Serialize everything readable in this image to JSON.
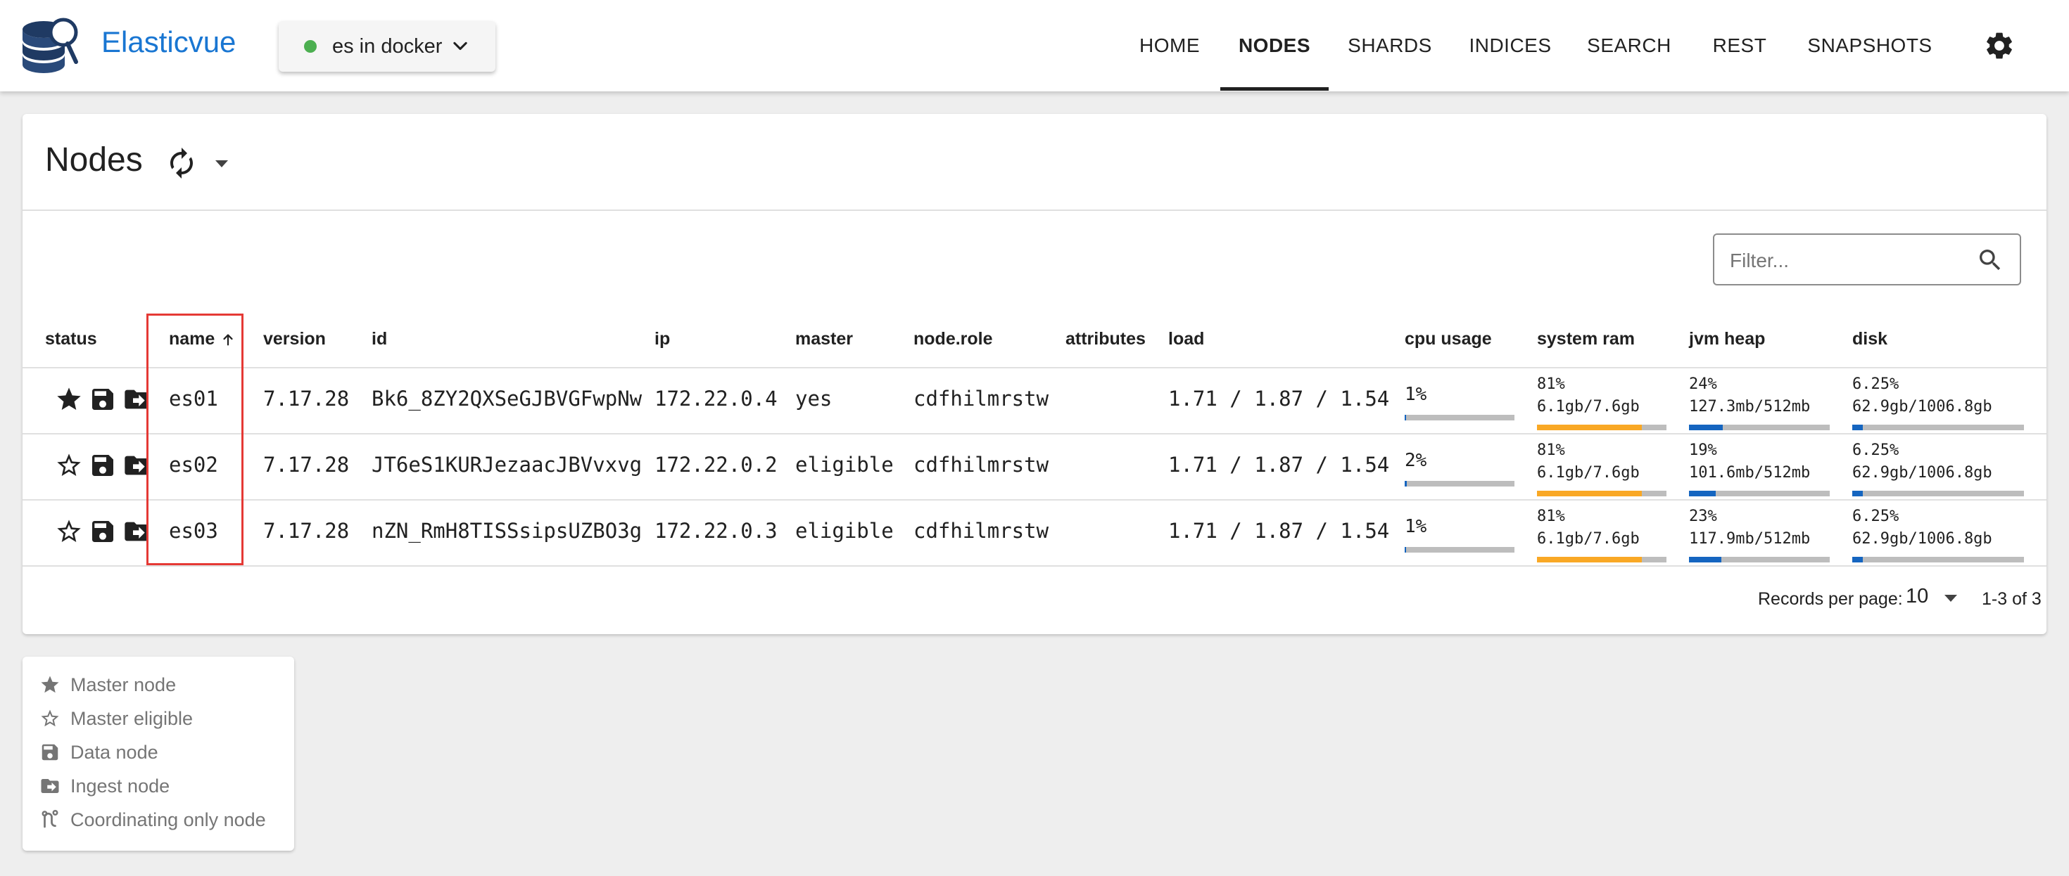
{
  "app": {
    "title": "Elasticvue"
  },
  "cluster": {
    "label": "es in docker",
    "status_color": "#4caf50"
  },
  "nav": [
    {
      "label": "HOME"
    },
    {
      "label": "NODES",
      "active": true
    },
    {
      "label": "SHARDS"
    },
    {
      "label": "INDICES"
    },
    {
      "label": "SEARCH"
    },
    {
      "label": "REST"
    },
    {
      "label": "SNAPSHOTS"
    }
  ],
  "page": {
    "title": "Nodes"
  },
  "filter": {
    "placeholder": "Filter...",
    "value": ""
  },
  "table": {
    "columns": [
      "status",
      "name",
      "version",
      "id",
      "ip",
      "master",
      "node.role",
      "attributes",
      "load",
      "cpu usage",
      "system ram",
      "jvm heap",
      "disk"
    ],
    "sort": {
      "column": "name",
      "direction": "ascending"
    },
    "rows": [
      {
        "status": [
          "master-node",
          "data-node",
          "ingest-node"
        ],
        "name": "es01",
        "version": "7.17.28",
        "id": "Bk6_8ZY2QXSeGJBVGFwpNw",
        "ip": "172.22.0.4",
        "master": "yes",
        "role": "cdfhilmrstw",
        "attributes": "",
        "load": "1.71 / 1.87 / 1.54",
        "cpu": {
          "pct": "1%",
          "value": 1
        },
        "ram": {
          "pct": "81%",
          "detail": "6.1gb/7.6gb",
          "value": 81
        },
        "heap": {
          "pct": "24%",
          "detail": "127.3mb/512mb",
          "value": 24
        },
        "disk": {
          "pct": "6.25%",
          "detail": "62.9gb/1006.8gb",
          "value": 6.25
        }
      },
      {
        "status": [
          "master-eligible",
          "data-node",
          "ingest-node"
        ],
        "name": "es02",
        "version": "7.17.28",
        "id": "JT6eS1KURJezaacJBVvxvg",
        "ip": "172.22.0.2",
        "master": "eligible",
        "role": "cdfhilmrstw",
        "attributes": "",
        "load": "1.71 / 1.87 / 1.54",
        "cpu": {
          "pct": "2%",
          "value": 2
        },
        "ram": {
          "pct": "81%",
          "detail": "6.1gb/7.6gb",
          "value": 81
        },
        "heap": {
          "pct": "19%",
          "detail": "101.6mb/512mb",
          "value": 19
        },
        "disk": {
          "pct": "6.25%",
          "detail": "62.9gb/1006.8gb",
          "value": 6.25
        }
      },
      {
        "status": [
          "master-eligible",
          "data-node",
          "ingest-node"
        ],
        "name": "es03",
        "version": "7.17.28",
        "id": "nZN_RmH8TISSsipsUZBO3g",
        "ip": "172.22.0.3",
        "master": "eligible",
        "role": "cdfhilmrstw",
        "attributes": "",
        "load": "1.71 / 1.87 / 1.54",
        "cpu": {
          "pct": "1%",
          "value": 1
        },
        "ram": {
          "pct": "81%",
          "detail": "6.1gb/7.6gb",
          "value": 81
        },
        "heap": {
          "pct": "23%",
          "detail": "117.9mb/512mb",
          "value": 23
        },
        "disk": {
          "pct": "6.25%",
          "detail": "62.9gb/1006.8gb",
          "value": 6.25
        }
      }
    ]
  },
  "pagination": {
    "label": "Records per page:",
    "per_page": "10",
    "range": "1-3 of 3"
  },
  "legend": [
    {
      "icon": "star-filled-icon",
      "label": "Master node"
    },
    {
      "icon": "star-outline-icon",
      "label": "Master eligible"
    },
    {
      "icon": "save-icon",
      "label": "Data node"
    },
    {
      "icon": "folder-arrow-icon",
      "label": "Ingest node"
    },
    {
      "icon": "route-icon",
      "label": "Coordinating only node"
    }
  ],
  "colors": {
    "brand": "#1976d2",
    "ram_bar": "#f9a825",
    "heap_bar": "#1565c0",
    "track": "#bdbdbd",
    "highlight": "#e53935"
  }
}
